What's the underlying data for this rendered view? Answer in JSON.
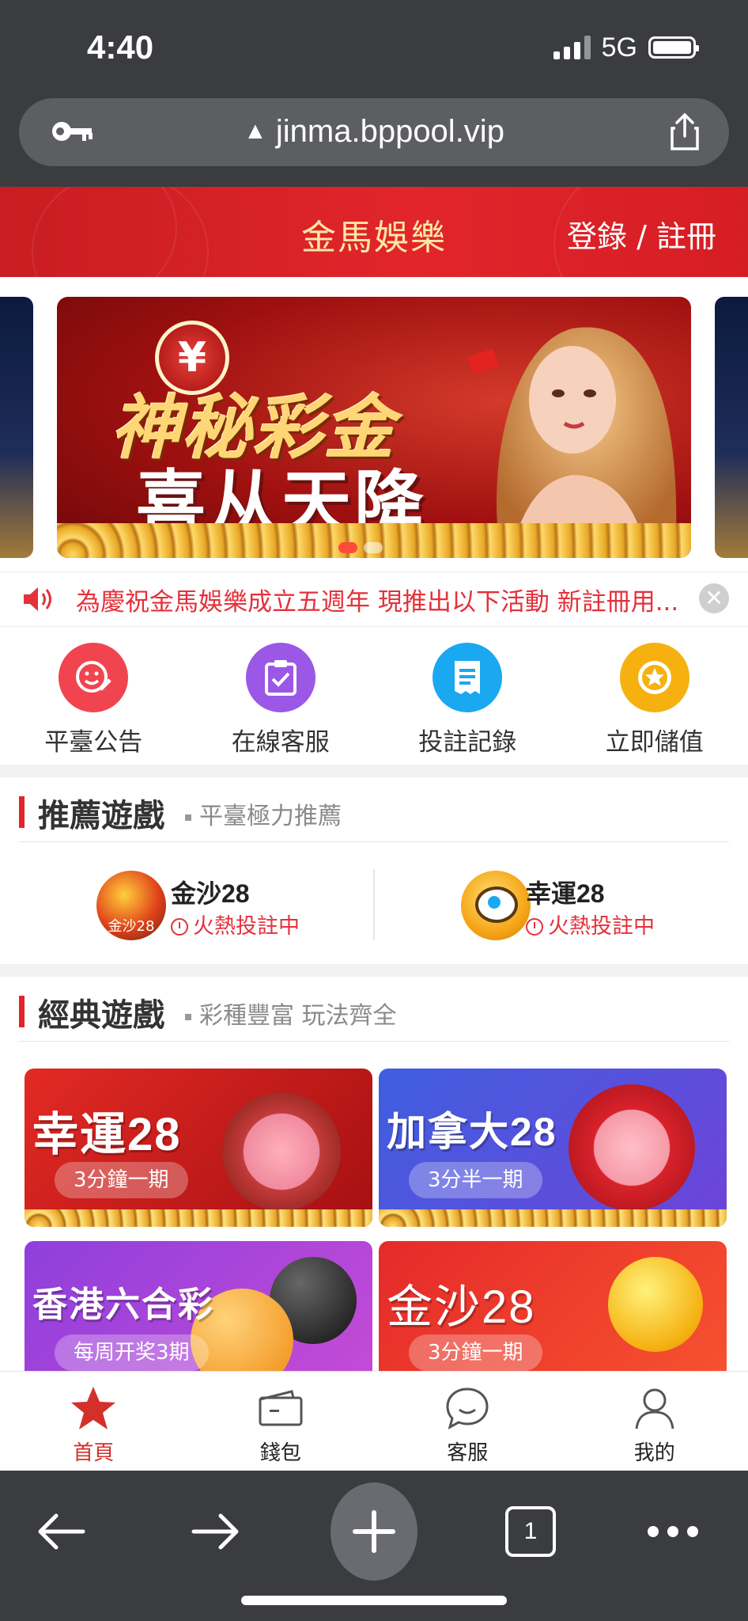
{
  "status": {
    "time": "4:40",
    "network": "5G"
  },
  "browser": {
    "url": "jinma.bppool.vip",
    "tab_count": "1"
  },
  "site": {
    "title": "金馬娛樂",
    "login": "登錄 / 註冊"
  },
  "banner": {
    "line1": "神秘彩金",
    "line2": "喜从天降",
    "coin_symbol": "¥"
  },
  "marquee": {
    "text": "為慶祝金馬娛樂成立五週年 現推出以下活動 新註冊用...",
    "close": "✕"
  },
  "quick_links": [
    {
      "label": "平臺公告",
      "color": "#f0454f",
      "icon": "smile-edit-icon"
    },
    {
      "label": "在線客服",
      "color": "#9b57e6",
      "icon": "clipboard-check-icon"
    },
    {
      "label": "投註記錄",
      "color": "#1aa8f0",
      "icon": "receipt-icon"
    },
    {
      "label": "立即儲值",
      "color": "#f6b111",
      "icon": "star-coin-icon"
    }
  ],
  "recommended": {
    "title": "推薦遊戲",
    "subtitle": "平臺極力推薦",
    "items": [
      {
        "name": "金沙28",
        "status": "火熱投註中",
        "icon_text": "金沙28"
      },
      {
        "name": "幸運28",
        "status": "火熱投註中"
      }
    ]
  },
  "classic": {
    "title": "經典遊戲",
    "subtitle": "彩種豐富 玩法齊全",
    "cards": [
      {
        "title": "幸運28",
        "badge": "3分鐘一期",
        "bg_from": "#e32a24",
        "bg_to": "#a50f12"
      },
      {
        "title": "加拿大28",
        "badge": "3分半一期",
        "bg_from": "#3f5fe0",
        "bg_to": "#6e43d8"
      },
      {
        "title": "香港六合彩",
        "badge": "每周开奖3期",
        "bg_from": "#8e3fdc",
        "bg_to": "#c74bd6"
      },
      {
        "title": "金沙28",
        "badge": "3分鐘一期",
        "bg_from": "#e52a2a",
        "bg_to": "#f7532f"
      }
    ]
  },
  "tabbar": [
    {
      "label": "首頁",
      "icon": "star-icon",
      "active": true
    },
    {
      "label": "錢包",
      "icon": "wallet-icon",
      "active": false
    },
    {
      "label": "客服",
      "icon": "chat-bubble-icon",
      "active": false
    },
    {
      "label": "我的",
      "icon": "user-icon",
      "active": false
    }
  ],
  "colors": {
    "brand_red": "#e1252b",
    "title_gold": "#fde6a3",
    "alert_red": "#e4313a",
    "chrome_dark": "#3b3c40"
  }
}
